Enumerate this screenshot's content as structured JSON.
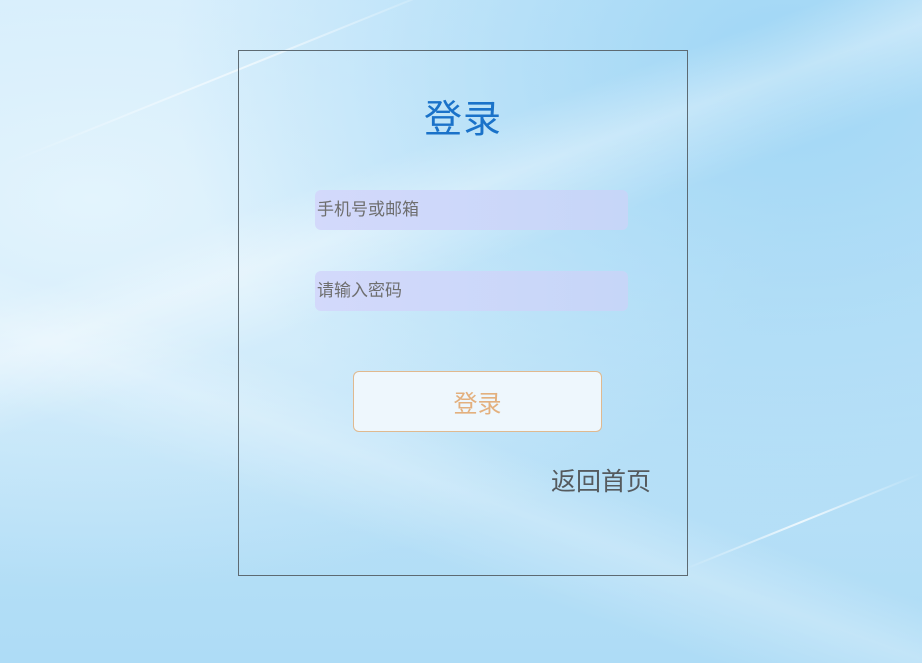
{
  "login_form": {
    "title": "登录",
    "account_field": {
      "value": "",
      "placeholder": "手机号或邮箱"
    },
    "password_field": {
      "value": "",
      "placeholder": "请输入密码"
    },
    "submit_label": "登录",
    "back_home_label": "返回首页"
  },
  "colors": {
    "title": "#1a72c9",
    "input_bg": "#c6d6f8",
    "button_text": "#e3b07e",
    "button_border": "#e0b98f",
    "panel_border": "#5d6a72",
    "link_text": "#555a5e"
  }
}
